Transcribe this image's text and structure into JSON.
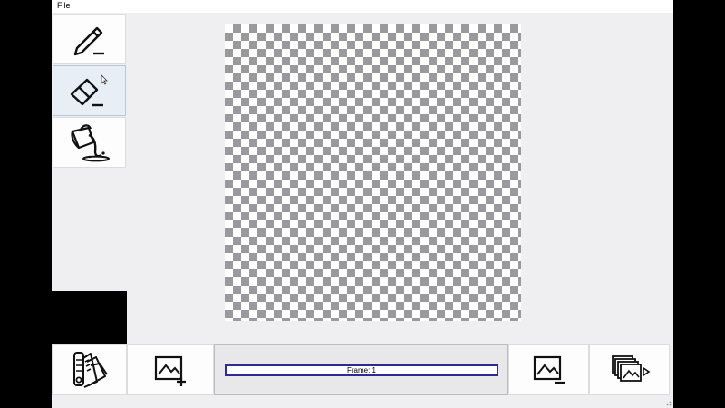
{
  "menu": {
    "file_label": "File"
  },
  "tools": [
    {
      "name": "pencil",
      "icon": "pencil-icon"
    },
    {
      "name": "eraser",
      "icon": "eraser-icon",
      "active": true
    },
    {
      "name": "fill",
      "icon": "paint-bucket-icon"
    }
  ],
  "primary_color": "#000000",
  "frame": {
    "label": "Frame: 1"
  },
  "bottom_buttons": {
    "palette": "color-palette-icon",
    "add_frame": "add-image-icon",
    "remove_frame": "remove-image-icon",
    "play": "frames-play-icon"
  }
}
